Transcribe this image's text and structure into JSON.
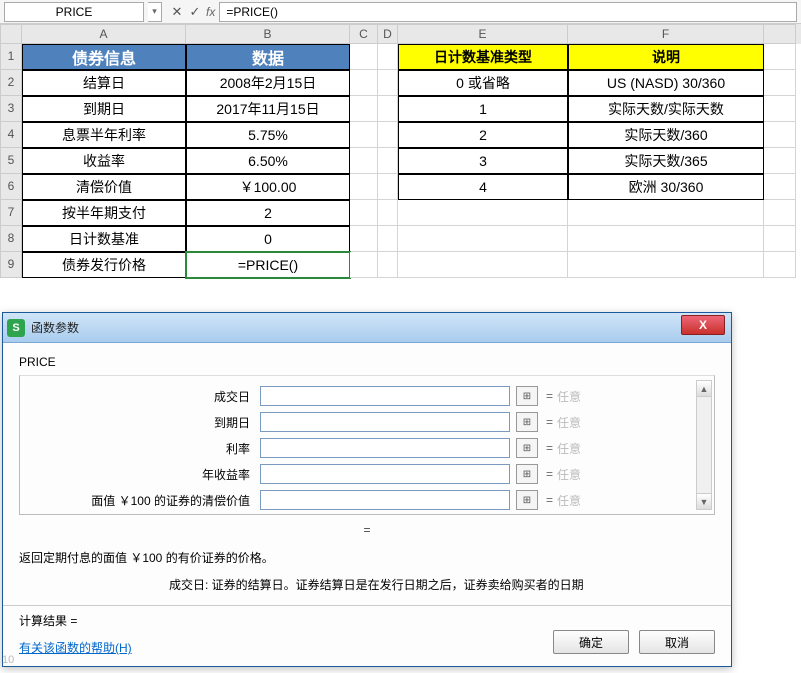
{
  "formula_bar": {
    "name_box": "PRICE",
    "cancel_icon": "✕",
    "accept_icon": "✓",
    "fx_label": "fx",
    "formula": "=PRICE()"
  },
  "columns": [
    "A",
    "B",
    "C",
    "D",
    "E",
    "F"
  ],
  "row_numbers": [
    "1",
    "2",
    "3",
    "4",
    "5",
    "6",
    "7",
    "8",
    "9"
  ],
  "left_table": {
    "header": {
      "col1": "债券信息",
      "col2": "数据"
    },
    "rows": [
      {
        "label": "结算日",
        "value": "2008年2月15日"
      },
      {
        "label": "到期日",
        "value": "2017年11月15日"
      },
      {
        "label": "息票半年利率",
        "value": "5.75%"
      },
      {
        "label": "收益率",
        "value": "6.50%"
      },
      {
        "label": "清偿价值",
        "value": "￥100.00"
      },
      {
        "label": "按半年期支付",
        "value": "2"
      },
      {
        "label": "日计数基准",
        "value": "0"
      },
      {
        "label": "债券发行价格",
        "value": "=PRICE()"
      }
    ]
  },
  "right_table": {
    "header": {
      "col1": "日计数基准类型",
      "col2": "说明"
    },
    "rows": [
      {
        "type": "0 或省略",
        "desc": "US (NASD) 30/360"
      },
      {
        "type": "1",
        "desc": "实际天数/实际天数"
      },
      {
        "type": "2",
        "desc": "实际天数/360"
      },
      {
        "type": "3",
        "desc": "实际天数/365"
      },
      {
        "type": "4",
        "desc": "欧洲 30/360"
      }
    ]
  },
  "dialog": {
    "title": "函数参数",
    "close": "X",
    "function_name": "PRICE",
    "args": [
      {
        "label": "成交日",
        "value": "",
        "any": "任意"
      },
      {
        "label": "到期日",
        "value": "",
        "any": "任意"
      },
      {
        "label": "利率",
        "value": "",
        "any": "任意"
      },
      {
        "label": "年收益率",
        "value": "",
        "any": "任意"
      },
      {
        "label": "面值 ￥100 的证券的清偿价值",
        "value": "",
        "any": "任意"
      }
    ],
    "result_equals": "=",
    "description": "返回定期付息的面值 ￥100 的有价证券的价格。",
    "arg_desc": "成交日: 证券的结算日。证券结算日是在发行日期之后，证券卖给购买者的日期",
    "calc_result": "计算结果 =",
    "help_link": "有关该函数的帮助(H)",
    "ok": "确定",
    "cancel": "取消"
  },
  "faint_row": "10"
}
